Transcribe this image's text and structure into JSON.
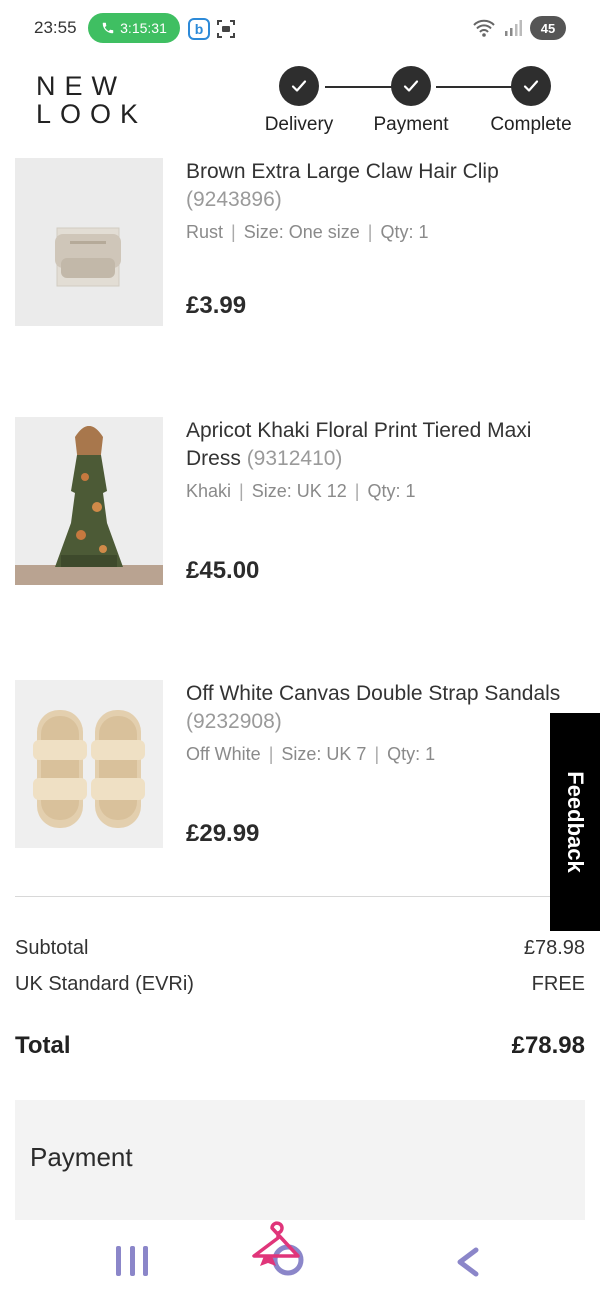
{
  "status_bar": {
    "time": "23:55",
    "call_timer": "3:15:31",
    "b_app_letter": "b",
    "battery": "45",
    "colors": {
      "call": "#3fbf62",
      "b_app": "#2d8ad8"
    }
  },
  "header": {
    "brand_line1": "NEW",
    "brand_line2": "LOOK",
    "steps": [
      {
        "label": "Delivery",
        "icon": "check-icon"
      },
      {
        "label": "Payment",
        "icon": "check-icon"
      },
      {
        "label": "Complete",
        "icon": "check-icon"
      }
    ]
  },
  "items": [
    {
      "name": "Brown Extra Large Claw Hair Clip",
      "code": "(9243896)",
      "colour": "Rust",
      "size": "Size: One size",
      "qty": "Qty: 1",
      "price": "£3.99"
    },
    {
      "name": "Apricot Khaki Floral Print Tiered Maxi Dress",
      "code": "(9312410)",
      "colour": "Khaki",
      "size": "Size: UK 12",
      "qty": "Qty: 1",
      "price": "£45.00"
    },
    {
      "name": "Off White Canvas Double Strap Sandals",
      "code": "(9232908)",
      "colour": "Off White",
      "size": "Size: UK 7",
      "qty": "Qty: 1",
      "price": "£29.99"
    }
  ],
  "summary": {
    "subtotal_label": "Subtotal",
    "subtotal_value": "£78.98",
    "shipping_label": "UK Standard (EVRi)",
    "shipping_value": "FREE",
    "total_label": "Total",
    "total_value": "£78.98"
  },
  "payment": {
    "title": "Payment"
  },
  "feedback": {
    "label": "Feedback"
  },
  "nav": {
    "accent": "#8b86c9",
    "hanger_color": "#e0357a"
  }
}
